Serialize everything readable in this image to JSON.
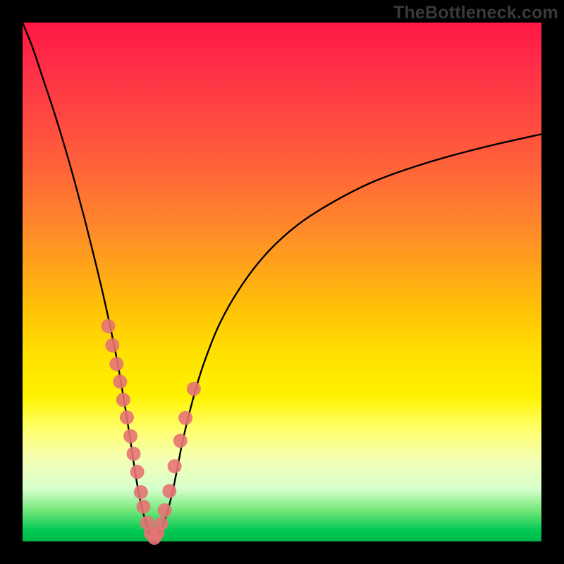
{
  "watermark": "TheBottleneck.com",
  "colors": {
    "frame": "#000000",
    "curve": "#000000",
    "dot": "#e57373",
    "gradient_top": "#ff1744",
    "gradient_mid": "#ffe400",
    "gradient_bottom": "#00c853"
  },
  "chart_data": {
    "type": "line",
    "title": "",
    "xlabel": "",
    "ylabel": "",
    "xlim": [
      0,
      100
    ],
    "ylim": [
      0,
      100
    ],
    "grid": false,
    "legend": false,
    "series": [
      {
        "name": "left-branch",
        "x": [
          0,
          2,
          4,
          6,
          8,
          10,
          12,
          14,
          16,
          18,
          19,
          20,
          21,
          22,
          23,
          24,
          24.6,
          25.2
        ],
        "y": [
          100,
          95,
          89,
          83,
          76.5,
          69.5,
          62,
          54,
          45.5,
          36,
          30.5,
          24.5,
          18,
          11.5,
          6.5,
          3,
          1.3,
          0.5
        ]
      },
      {
        "name": "right-branch",
        "x": [
          25.4,
          26,
          27,
          28,
          29,
          30,
          31,
          33,
          35,
          38,
          42,
          47,
          53,
          60,
          68,
          78,
          89,
          100
        ],
        "y": [
          0.5,
          1.3,
          3,
          6,
          10,
          15,
          20,
          28,
          34.5,
          42,
          49,
          55.5,
          61,
          65.5,
          69.5,
          73,
          76,
          78.5
        ]
      }
    ],
    "scatter": {
      "name": "dots",
      "x": [
        16.5,
        17.3,
        18.1,
        18.8,
        19.4,
        20.1,
        20.8,
        21.4,
        22.1,
        22.8,
        23.3,
        24.0,
        24.7,
        25.4,
        26.0,
        26.7,
        27.4,
        28.3,
        29.3,
        30.4,
        31.4,
        33.0
      ],
      "y": [
        41.5,
        37.8,
        34.2,
        30.8,
        27.3,
        23.9,
        20.3,
        16.9,
        13.4,
        9.5,
        6.7,
        3.6,
        1.6,
        0.7,
        1.6,
        3.4,
        6.0,
        9.7,
        14.5,
        19.4,
        23.8,
        29.4
      ]
    }
  }
}
